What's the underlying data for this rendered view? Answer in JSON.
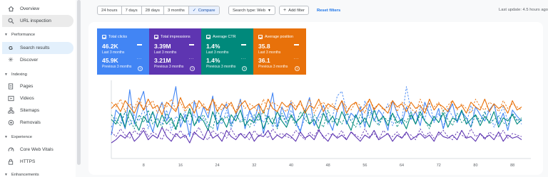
{
  "sidebar": {
    "items": [
      {
        "key": "overview",
        "label": "Overview",
        "icon": "home-icon"
      },
      {
        "key": "url-inspection",
        "label": "URL inspection",
        "icon": "search-icon"
      }
    ],
    "sections": [
      {
        "label": "Performance",
        "items": [
          {
            "label": "Search results",
            "icon": "google-g-icon"
          },
          {
            "label": "Discover",
            "icon": "asterisk-icon"
          }
        ]
      },
      {
        "label": "Indexing",
        "items": [
          {
            "label": "Pages",
            "icon": "pages-icon"
          },
          {
            "label": "Videos",
            "icon": "video-icon"
          },
          {
            "label": "Sitemaps",
            "icon": "sitemap-icon"
          },
          {
            "label": "Removals",
            "icon": "removals-icon"
          }
        ]
      },
      {
        "label": "Experience",
        "items": [
          {
            "label": "Core Web Vitals",
            "icon": "speed-icon"
          },
          {
            "label": "HTTPS",
            "icon": "lock-icon"
          }
        ]
      },
      {
        "label": "Enhancements",
        "items": []
      }
    ]
  },
  "toolbar": {
    "date_ranges": [
      "24 hours",
      "7 days",
      "28 days",
      "3 months"
    ],
    "compare_label": "Compare",
    "search_type_label": "Search type: Web",
    "add_filter_label": "Add filter",
    "reset_label": "Reset filters",
    "last_update": "Last update: 4.5 hours ago"
  },
  "metrics": [
    {
      "title": "Total clicks",
      "value1": "46.2K",
      "label1": "Last 3 months",
      "value2": "45.9K",
      "label2": "Previous 3 months",
      "color": "#4285f4"
    },
    {
      "title": "Total impressions",
      "value1": "3.39M",
      "label1": "Last 3 months",
      "value2": "3.21M",
      "label2": "Previous 3 months",
      "color": "#5e35b1"
    },
    {
      "title": "Average CTR",
      "value1": "1.4%",
      "label1": "Last 3 months",
      "value2": "1.4%",
      "label2": "Previous 3 months",
      "color": "#00897b"
    },
    {
      "title": "Average position",
      "value1": "35.8",
      "label1": "Last 3 months",
      "value2": "36.1",
      "label2": "Previous 3 months",
      "color": "#e8710a"
    }
  ],
  "chart_data": {
    "type": "line",
    "x_ticks": [
      "8",
      "16",
      "24",
      "32",
      "40",
      "48",
      "56",
      "64",
      "72",
      "80",
      "88"
    ],
    "x_range": [
      1,
      92
    ],
    "y_range": [
      0,
      100
    ],
    "grid": false,
    "series": [
      {
        "color": "#4285f4",
        "dashed": false,
        "values": [
          30,
          62,
          55,
          38,
          88,
          44,
          70,
          86,
          50,
          34,
          58,
          72,
          48,
          64,
          92,
          40,
          56,
          28,
          74,
          46,
          66,
          52,
          80,
          36,
          60,
          70,
          44,
          54,
          76,
          38,
          62,
          48,
          70,
          32,
          58,
          84,
          40,
          66,
          50,
          72,
          46,
          34,
          60,
          78,
          42,
          56,
          68,
          50,
          36,
          62,
          74,
          44,
          58,
          52,
          66,
          40,
          70,
          48,
          62,
          54,
          36,
          74,
          58,
          44,
          66,
          50,
          60,
          42,
          72,
          56,
          48,
          64,
          38,
          58,
          70,
          46,
          60,
          52,
          40,
          66,
          56,
          48,
          62,
          70,
          44,
          58,
          36,
          62,
          54,
          48
        ]
      },
      {
        "color": "#4285f4",
        "dashed": true,
        "values": [
          40,
          52,
          46,
          60,
          42,
          56,
          48,
          64,
          38,
          58,
          50,
          44,
          62,
          36,
          54,
          48,
          60,
          42,
          56,
          46,
          52,
          40,
          58,
          50,
          44,
          62,
          38,
          56,
          48,
          52,
          60,
          42,
          54,
          46,
          58,
          40,
          50,
          56,
          44,
          62,
          48,
          36,
          52,
          58,
          42,
          50,
          60,
          44,
          54,
          80,
          86,
          62,
          48,
          56,
          40,
          74,
          52,
          66,
          44,
          58,
          70,
          42,
          56,
          48,
          92,
          60,
          44,
          66,
          50,
          72,
          46,
          58,
          40,
          64,
          54,
          48,
          60,
          44,
          68,
          52,
          46,
          58,
          62,
          40,
          54,
          66,
          48,
          58,
          50,
          44
        ]
      },
      {
        "color": "#5e35b1",
        "dashed": false,
        "values": [
          20,
          24,
          30,
          26,
          34,
          22,
          28,
          36,
          24,
          30,
          26,
          40,
          28,
          22,
          32,
          26,
          30,
          20,
          34,
          28,
          24,
          38,
          26,
          30,
          22,
          36,
          28,
          24,
          32,
          26,
          34,
          22,
          30,
          28,
          36,
          24,
          30,
          26,
          32,
          28,
          22,
          34,
          26,
          30,
          24,
          36,
          28,
          22,
          32,
          26,
          30,
          24,
          34,
          28,
          22,
          30,
          26,
          36,
          24,
          28,
          32,
          22,
          30,
          26,
          34,
          24,
          28,
          32,
          26,
          30,
          22,
          34,
          28,
          26,
          30,
          24,
          36,
          26,
          28,
          22,
          32,
          26,
          30,
          24,
          34,
          22,
          30,
          26,
          28,
          24
        ]
      },
      {
        "color": "#5e35b1",
        "dashed": true,
        "values": [
          34,
          28,
          38,
          30,
          26,
          36,
          30,
          40,
          28,
          34,
          30,
          24,
          38,
          32,
          28,
          36,
          26,
          34,
          30,
          40,
          28,
          24,
          36,
          30,
          34,
          26,
          38,
          28,
          32,
          30,
          24,
          36,
          28,
          34,
          26,
          38,
          30,
          32,
          28,
          26,
          36,
          30,
          24,
          34,
          28,
          38,
          26,
          32,
          30,
          28,
          36,
          24,
          34,
          30,
          26,
          38,
          28,
          32,
          24,
          36,
          30,
          28,
          34,
          26,
          32,
          30,
          24,
          38,
          28,
          34,
          26,
          30,
          36,
          28,
          24,
          34,
          30,
          26,
          38,
          28,
          32,
          24,
          34,
          30,
          28,
          36,
          26,
          32,
          30,
          28
        ]
      },
      {
        "color": "#00897b",
        "dashed": false,
        "values": [
          50,
          44,
          58,
          40,
          62,
          48,
          36,
          54,
          46,
          60,
          40,
          56,
          44,
          52,
          38,
          58,
          46,
          64,
          42,
          54,
          48,
          36,
          60,
          44,
          52,
          40,
          56,
          48,
          62,
          42,
          50,
          46,
          58,
          38,
          54,
          44,
          60,
          48,
          40,
          56,
          46,
          52,
          62,
          44,
          50,
          38,
          58,
          46,
          54,
          42,
          60,
          48,
          36,
          56,
          44,
          52,
          40,
          62,
          48,
          54,
          42,
          58,
          46,
          50,
          38,
          56,
          44,
          60,
          48,
          42,
          54,
          46,
          58,
          40,
          52,
          48,
          62,
          44,
          50,
          56,
          42,
          54,
          46,
          60,
          40,
          52,
          48,
          56,
          44,
          50
        ]
      },
      {
        "color": "#00897b",
        "dashed": true,
        "values": [
          56,
          48,
          42,
          60,
          50,
          38,
          56,
          46,
          62,
          44,
          52,
          40,
          58,
          48,
          36,
          54,
          46,
          60,
          42,
          50,
          56,
          44,
          38,
          62,
          48,
          54,
          42,
          58,
          46,
          50,
          40,
          56,
          48,
          62,
          44,
          52,
          38,
          58,
          46,
          54,
          42,
          60,
          50,
          44,
          56,
          48,
          40,
          62,
          46,
          52,
          44,
          58,
          48,
          40,
          56,
          46,
          62,
          50,
          42,
          54,
          48,
          58,
          40,
          52,
          46,
          60,
          44,
          56,
          48,
          38,
          54,
          46,
          62,
          50,
          42,
          58,
          46,
          52,
          40,
          56,
          48,
          60,
          44,
          50,
          54,
          46,
          42,
          58,
          48,
          52
        ]
      },
      {
        "color": "#e8710a",
        "dashed": false,
        "values": [
          64,
          70,
          60,
          74,
          66,
          58,
          72,
          62,
          76,
          64,
          68,
          56,
          72,
          66,
          60,
          78,
          64,
          70,
          58,
          74,
          66,
          62,
          76,
          60,
          70,
          64,
          72,
          58,
          68,
          74,
          62,
          66,
          70,
          58,
          76,
          64,
          60,
          72,
          66,
          70,
          62,
          74,
          58,
          68,
          64,
          76,
          60,
          70,
          66,
          62,
          74,
          58,
          68,
          72,
          60,
          66,
          76,
          62,
          70,
          64,
          58,
          74,
          66,
          70,
          60,
          72,
          64,
          68,
          58,
          76,
          62,
          70,
          66,
          60,
          74,
          64,
          68,
          58,
          72,
          66,
          62,
          76,
          60,
          70,
          64,
          68,
          58,
          74,
          62,
          66
        ]
      },
      {
        "color": "#e8710a",
        "dashed": true,
        "values": [
          72,
          66,
          76,
          60,
          70,
          64,
          78,
          62,
          68,
          74,
          58,
          70,
          66,
          76,
          62,
          72,
          60,
          68,
          74,
          64,
          70,
          58,
          76,
          66,
          62,
          72,
          68,
          60,
          74,
          64,
          70,
          66,
          58,
          76,
          62,
          72,
          68,
          64,
          60,
          74,
          66,
          70,
          62,
          76,
          58,
          68,
          72,
          64,
          70,
          60,
          74,
          66,
          62,
          72,
          68,
          58,
          76,
          64,
          70,
          62,
          66,
          74,
          60,
          72,
          68,
          64,
          58,
          76,
          62,
          70,
          66,
          72,
          60,
          68,
          74,
          62,
          70,
          64,
          58,
          76,
          66,
          62,
          72,
          68,
          60,
          74,
          64,
          70,
          66,
          62
        ]
      }
    ]
  }
}
